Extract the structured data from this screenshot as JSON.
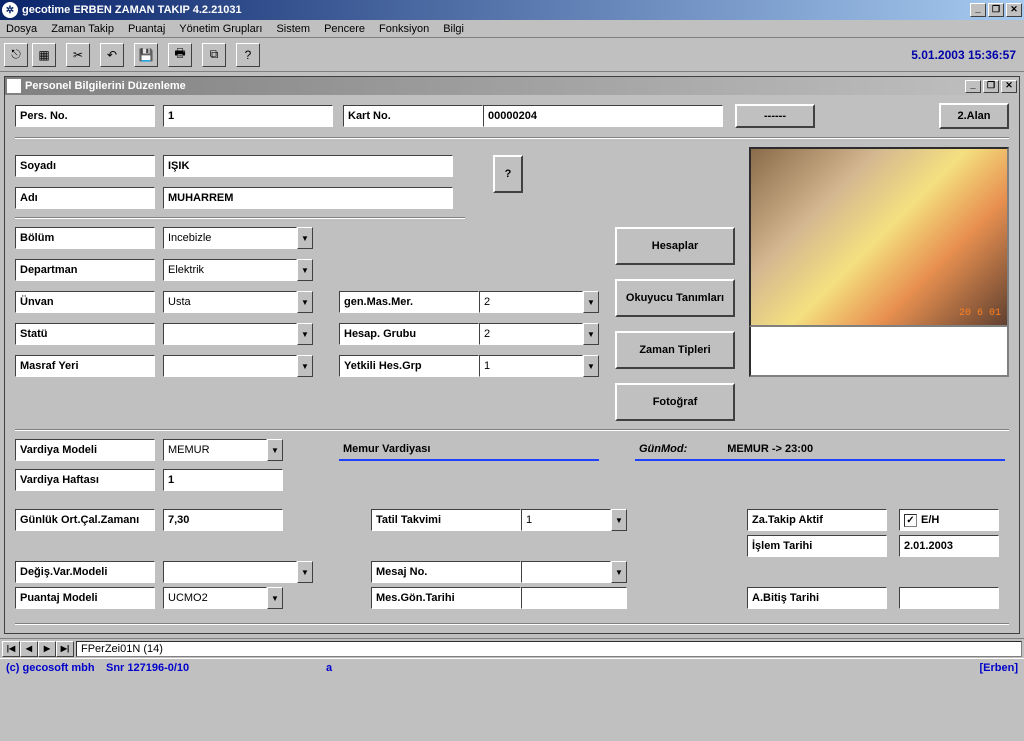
{
  "app": {
    "title": "gecotime  ERBEN ZAMAN TAKIP  4.2.21031",
    "datetime": "5.01.2003  15:36:57"
  },
  "menu": {
    "dosya": "Dosya",
    "zaman": "Zaman Takip",
    "puantaj": "Puantaj",
    "yonetim": "Yönetim Grupları",
    "sistem": "Sistem",
    "pencere": "Pencere",
    "fonksiyon": "Fonksiyon",
    "bilgi": "Bilgi"
  },
  "child": {
    "title": "Personel Bilgilerini Düzenleme"
  },
  "top": {
    "pers_no_label": "Pers. No.",
    "pers_no": "1",
    "kart_no_label": "Kart No.",
    "kart_no": "00000204",
    "dash_btn": "------",
    "alan_btn": "2.Alan"
  },
  "name": {
    "soyadi_label": "Soyadı",
    "soyadi": "IŞIK",
    "adi_label": "Adı",
    "adi": "MUHARREM",
    "q_btn": "?"
  },
  "side_btns": {
    "hesaplar": "Hesaplar",
    "okuyucu": "Okuyucu Tanımları",
    "zaman": "Zaman Tipleri",
    "foto": "Fotoğraf"
  },
  "org": {
    "bolum_label": "Bölüm",
    "bolum": "Incebizle",
    "dept_label": "Departman",
    "dept": "Elektrik",
    "unvan_label": "Ünvan",
    "unvan": "Usta",
    "statu_label": "Statü",
    "statu": "",
    "masraf_label": "Masraf Yeri",
    "masraf": "",
    "genmas_label": "gen.Mas.Mer.",
    "genmas": "2",
    "hesgrp_label": "Hesap. Grubu",
    "hesgrp": "2",
    "yetkiligrp_label": "Yetkili Hes.Grp",
    "yetkiligrp": "1"
  },
  "shift": {
    "vardiya_model_label": "Vardiya Modeli",
    "vardiya_model": "MEMUR",
    "memur_vardiyasi": "Memur Vardiyası",
    "gunmod_label": "GünMod:",
    "gunmod": "MEMUR  -> 23:00",
    "vardiya_hafta_label": "Vardiya Haftası",
    "vardiya_hafta": "1",
    "gunluk_label": "Günlük Ort.Çal.Zamanı",
    "gunluk": "7,30",
    "degis_label": "Değiş.Var.Modeli",
    "degis": "",
    "puantaj_label": "Puantaj Modeli",
    "puantaj": "UCMO2",
    "tatil_label": "Tatil Takvimi",
    "tatil": "1",
    "mesaj_label": "Mesaj No.",
    "mesaj": "",
    "mesgon_label": "Mes.Gön.Tarihi",
    "mesgon": "",
    "zakip_label": "Za.Takip Aktif",
    "zakip_check": "E/H",
    "islem_label": "İşlem Tarihi",
    "islem": "2.01.2003",
    "abitis_label": "A.Bitiş Tarihi",
    "abitis": ""
  },
  "nav": {
    "record": "FPerZei01N (14)"
  },
  "status": {
    "copyright": "(c) gecosoft mbh",
    "snr": "Snr 127196-0/10",
    "mid": "a",
    "user": "[Erben]"
  }
}
